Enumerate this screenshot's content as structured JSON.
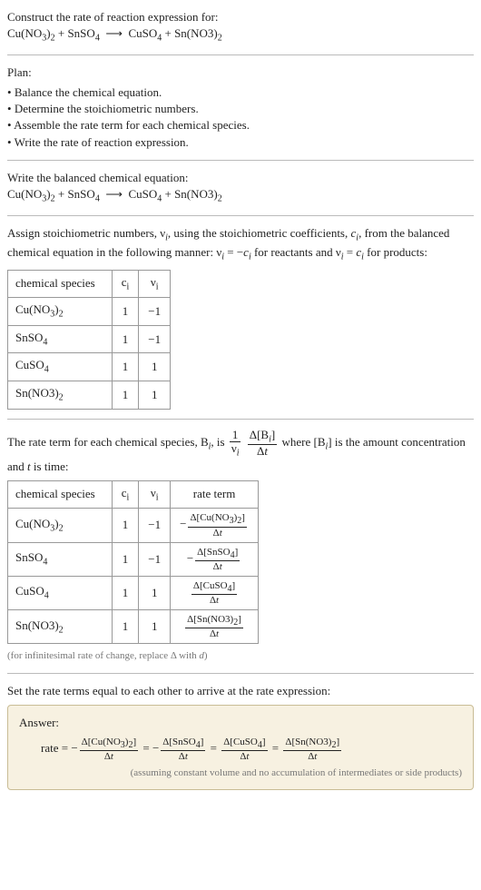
{
  "prompt_title": "Construct the rate of reaction expression for:",
  "equation_initial": "Cu(NO<sub>3</sub>)<sub>2</sub> + SnSO<sub>4</sub> &nbsp;⟶&nbsp; CuSO<sub>4</sub> + Sn(NO3)<sub>2</sub>",
  "plan_header": "Plan:",
  "plan_items": [
    "Balance the chemical equation.",
    "Determine the stoichiometric numbers.",
    "Assemble the rate term for each chemical species.",
    "Write the rate of reaction expression."
  ],
  "balanced_header": "Write the balanced chemical equation:",
  "equation_balanced": "Cu(NO<sub>3</sub>)<sub>2</sub> + SnSO<sub>4</sub> &nbsp;⟶&nbsp; CuSO<sub>4</sub> + Sn(NO3)<sub>2</sub>",
  "stoich_intro": "Assign stoichiometric numbers, ν<sub><i>i</i></sub>, using the stoichiometric coefficients, <i>c<sub>i</sub></i>, from the balanced chemical equation in the following manner: ν<sub><i>i</i></sub> = −<i>c<sub>i</sub></i> for reactants and ν<sub><i>i</i></sub> = <i>c<sub>i</sub></i> for products:",
  "table1": {
    "headers": [
      "chemical species",
      "c<sub>i</sub>",
      "ν<sub>i</sub>"
    ],
    "rows": [
      [
        "Cu(NO<sub>3</sub>)<sub>2</sub>",
        "1",
        "−1"
      ],
      [
        "SnSO<sub>4</sub>",
        "1",
        "−1"
      ],
      [
        "CuSO<sub>4</sub>",
        "1",
        "1"
      ],
      [
        "Sn(NO3)<sub>2</sub>",
        "1",
        "1"
      ]
    ]
  },
  "rate_term_intro_pre": "The rate term for each chemical species, B<sub><i>i</i></sub>, is ",
  "rate_term_intro_post": " where [B<sub><i>i</i></sub>] is the amount concentration and <i>t</i> is time:",
  "table2": {
    "headers": [
      "chemical species",
      "c<sub>i</sub>",
      "ν<sub>i</sub>",
      "rate term"
    ],
    "rows": [
      {
        "sp": "Cu(NO<sub>3</sub>)<sub>2</sub>",
        "c": "1",
        "v": "−1",
        "num": "Δ[Cu(NO<sub>3</sub>)<sub>2</sub>]",
        "neg": true
      },
      {
        "sp": "SnSO<sub>4</sub>",
        "c": "1",
        "v": "−1",
        "num": "Δ[SnSO<sub>4</sub>]",
        "neg": true
      },
      {
        "sp": "CuSO<sub>4</sub>",
        "c": "1",
        "v": "1",
        "num": "Δ[CuSO<sub>4</sub>]",
        "neg": false
      },
      {
        "sp": "Sn(NO3)<sub>2</sub>",
        "c": "1",
        "v": "1",
        "num": "Δ[Sn(NO3)<sub>2</sub>]",
        "neg": false
      }
    ]
  },
  "infinitesimal_note": "(for infinitesimal rate of change, replace Δ with <i>d</i>)",
  "final_header": "Set the rate terms equal to each other to arrive at the rate expression:",
  "answer_label": "Answer:",
  "rate_prefix": "rate = ",
  "rate_terms": [
    {
      "num": "Δ[Cu(NO<sub>3</sub>)<sub>2</sub>]",
      "neg": true
    },
    {
      "num": "Δ[SnSO<sub>4</sub>]",
      "neg": true
    },
    {
      "num": "Δ[CuSO<sub>4</sub>]",
      "neg": false
    },
    {
      "num": "Δ[Sn(NO3)<sub>2</sub>]",
      "neg": false
    }
  ],
  "rate_den": "Δ<i>t</i>",
  "assumption_note": "(assuming constant volume and no accumulation of intermediates or side products)"
}
